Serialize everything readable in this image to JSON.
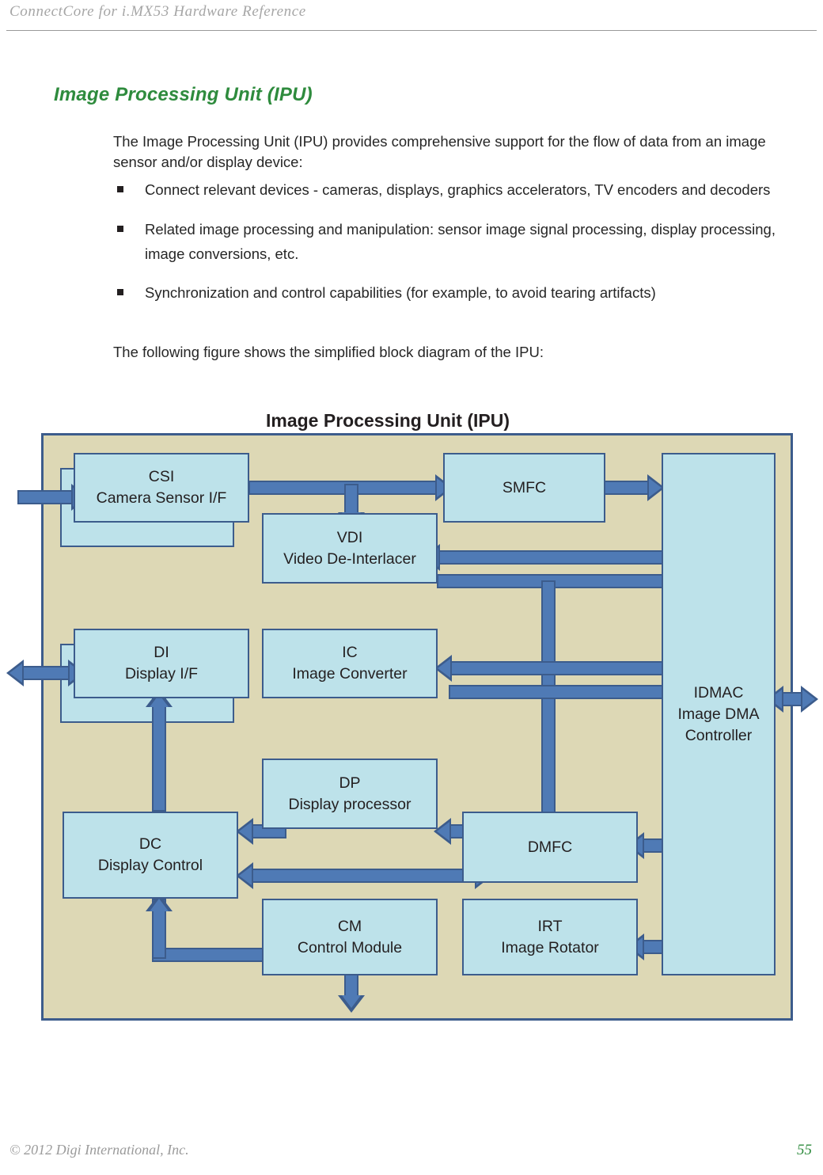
{
  "header": {
    "running_title": "ConnectCore for i.MX53 Hardware Reference"
  },
  "section": {
    "heading": "Image Processing Unit (IPU)",
    "intro_paragraph": "The Image Processing Unit (IPU) provides comprehensive support for the flow of data from an image sensor and/or display device:",
    "bullets": [
      "Connect relevant devices - cameras, displays, graphics accelerators, TV encoders and decoders",
      "Related image processing and manipulation: sensor image signal processing, display processing, image conversions, etc.",
      "Synchronization and control capabilities (for example, to avoid tearing artifacts)"
    ],
    "figure_lead_in": "The following figure shows the simplified block diagram of the IPU:"
  },
  "figure": {
    "title": "Image Processing Unit (IPU)",
    "colors": {
      "canvas_background": "#ddd8b5",
      "canvas_border": "#3c5c8c",
      "block_fill": "#bde2ea",
      "block_border": "#3c5c8c",
      "arrow_fill": "#4f7ab5",
      "arrow_border": "#3c5c8c",
      "heading_green": "#2e8b3d"
    },
    "blocks": [
      {
        "id": "csi",
        "abbr": "CSI",
        "name": "Camera Sensor I/F"
      },
      {
        "id": "smfc",
        "abbr": "SMFC",
        "name": ""
      },
      {
        "id": "vdi",
        "abbr": "VDI",
        "name": "Video De-Interlacer"
      },
      {
        "id": "di",
        "abbr": "DI",
        "name": "Display I/F"
      },
      {
        "id": "ic",
        "abbr": "IC",
        "name": "Image Converter"
      },
      {
        "id": "idmac",
        "abbr": "IDMAC",
        "name": "Image DMA Controller"
      },
      {
        "id": "dp",
        "abbr": "DP",
        "name": "Display processor"
      },
      {
        "id": "dc",
        "abbr": "DC",
        "name": "Display Control"
      },
      {
        "id": "dmfc",
        "abbr": "DMFC",
        "name": ""
      },
      {
        "id": "cm",
        "abbr": "CM",
        "name": "Control Module"
      },
      {
        "id": "irt",
        "abbr": "IRT",
        "name": "Image Rotator"
      }
    ],
    "block_labels": {
      "csi_line1": "CSI",
      "csi_line2": "Camera Sensor I/F",
      "smfc": "SMFC",
      "vdi_line1": "VDI",
      "vdi_line2": "Video De-Interlacer",
      "di_line1": "DI",
      "di_line2": "Display I/F",
      "ic_line1": "IC",
      "ic_line2": "Image Converter",
      "idmac_line1": "IDMAC",
      "idmac_line2": "Image DMA",
      "idmac_line3": "Controller",
      "dp_line1": "DP",
      "dp_line2": "Display processor",
      "dc_line1": "DC",
      "dc_line2": "Display Control",
      "dmfc": "DMFC",
      "cm_line1": "CM",
      "cm_line2": "Control Module",
      "irt_line1": "IRT",
      "irt_line2": "Image Rotator"
    },
    "connections": [
      {
        "from": "external",
        "to": "csi",
        "direction": "one-way"
      },
      {
        "from": "csi",
        "to": "smfc",
        "direction": "one-way"
      },
      {
        "from": "csi",
        "to": "vdi",
        "direction": "one-way"
      },
      {
        "from": "smfc",
        "to": "idmac",
        "direction": "one-way"
      },
      {
        "from": "idmac",
        "to": "vdi",
        "direction": "one-way"
      },
      {
        "from": "vdi",
        "to": "idmac",
        "direction": "one-way"
      },
      {
        "from": "idmac",
        "to": "ic",
        "direction": "one-way"
      },
      {
        "from": "ic",
        "to": "idmac",
        "direction": "one-way"
      },
      {
        "from": "vdi",
        "to": "dmfc",
        "direction": "one-way"
      },
      {
        "from": "dmfc",
        "to": "idmac",
        "direction": "two-way"
      },
      {
        "from": "dmfc",
        "to": "dp",
        "direction": "one-way"
      },
      {
        "from": "dp",
        "to": "dc",
        "direction": "one-way"
      },
      {
        "from": "dc",
        "to": "dmfc",
        "direction": "two-way"
      },
      {
        "from": "dc",
        "to": "di",
        "direction": "one-way"
      },
      {
        "from": "di",
        "to": "external",
        "direction": "two-way"
      },
      {
        "from": "irt",
        "to": "idmac",
        "direction": "two-way"
      },
      {
        "from": "cm",
        "to": "external",
        "direction": "two-way"
      },
      {
        "from": "idmac",
        "to": "external",
        "direction": "two-way"
      },
      {
        "from": "cm",
        "to": "dc",
        "direction": "one-way"
      }
    ]
  },
  "footer": {
    "copyright": "© 2012 Digi International, Inc.",
    "page_number": "55"
  }
}
